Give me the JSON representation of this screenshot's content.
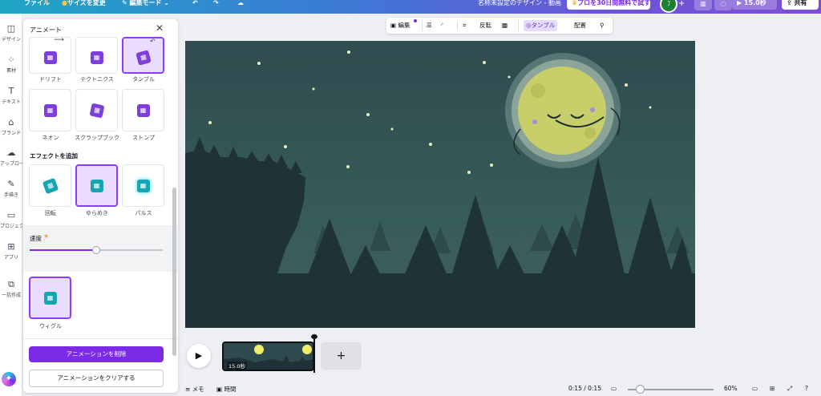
{
  "topbar": {
    "file": "ファイル",
    "resize": "サイズを変更",
    "edit_mode": "編集モード",
    "doc_title": "名称未設定のデザイン - 動画",
    "pro_trial": "プロを30日間無料で試す",
    "play_duration": "15.0秒",
    "share": "共有"
  },
  "rail": {
    "items": [
      {
        "label": "デザイン",
        "icon": "layout-icon"
      },
      {
        "label": "素材",
        "icon": "elements-icon"
      },
      {
        "label": "テキスト",
        "icon": "text-icon"
      },
      {
        "label": "ブランド",
        "icon": "brand-icon"
      },
      {
        "label": "アップロード",
        "icon": "upload-icon"
      },
      {
        "label": "手描き",
        "icon": "draw-icon"
      },
      {
        "label": "プロジェクト",
        "icon": "folder-icon"
      },
      {
        "label": "アプリ",
        "icon": "apps-icon"
      },
      {
        "label": "一括作成",
        "icon": "bulk-create-icon"
      }
    ]
  },
  "panel": {
    "title": "アニメート",
    "row1": [
      "ドリフト",
      "テクトニクス",
      "タンブル"
    ],
    "row2": [
      "ネオン",
      "スクラップブック",
      "ストンプ"
    ],
    "effects_heading": "エフェクトを追加",
    "effects": [
      "回転",
      "ゆらめき",
      "パルス"
    ],
    "speed_label": "速度",
    "speed_value": 0.5,
    "wiggle": "ウィグル",
    "remove_button": "アニメーションを削除",
    "clear_button": "アニメーションをクリアする"
  },
  "context_toolbar": {
    "edit": "編集",
    "flip": "反転",
    "tumble": "タンブル",
    "position": "配置"
  },
  "timeline": {
    "clip_duration": "15.0秒"
  },
  "bottombar": {
    "notes": "メモ",
    "time": "時間",
    "time_readout": "0:15 / 0:15",
    "zoom": "60%"
  },
  "colors": {
    "accent": "#7d2ae8",
    "selection_bg": "#e9dcff",
    "canvas_sky": "#2f4b4f",
    "forest_dark": "#1f3238",
    "moon": "#c8cf6a"
  }
}
